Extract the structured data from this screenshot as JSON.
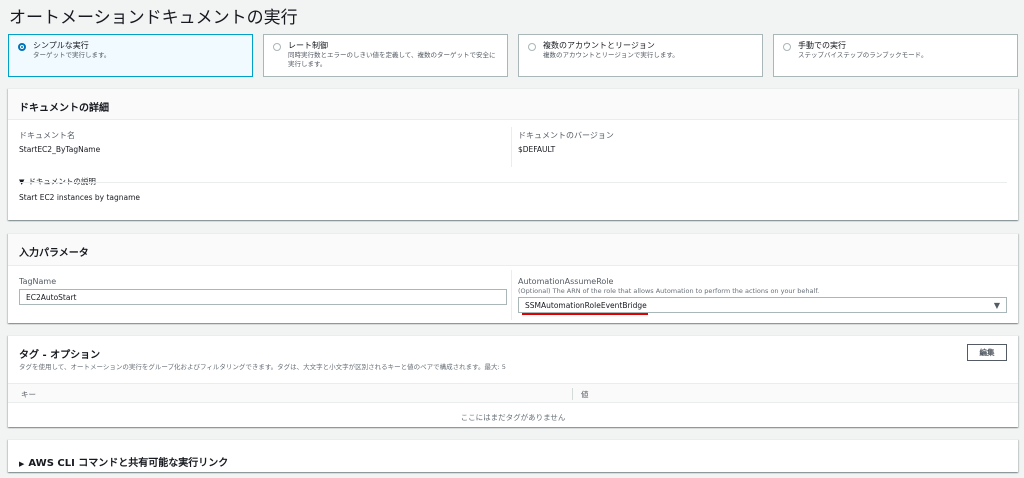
{
  "page": {
    "title": "オートメーションドキュメントの実行"
  },
  "options": [
    {
      "title": "シンプルな実行",
      "desc": "ターゲットで実行します。",
      "selected": true
    },
    {
      "title": "レート制御",
      "desc": "同時実行数とエラーのしきい値を定義して、複数のターゲットで安全に実行します。",
      "selected": false
    },
    {
      "title": "複数のアカウントとリージョン",
      "desc": "複数のアカウントとリージョンで実行します。",
      "selected": false
    },
    {
      "title": "手動での実行",
      "desc": "ステップバイステップのランブックモード。",
      "selected": false
    }
  ],
  "document_details": {
    "header": "ドキュメントの詳細",
    "name_label": "ドキュメント名",
    "name_value": "StartEC2_ByTagName",
    "version_label": "ドキュメントのバージョン",
    "version_value": "$DEFAULT",
    "description_toggle": "ドキュメントの説明",
    "description_value": "Start EC2 instances by tagname"
  },
  "input_params": {
    "header": "入力パラメータ",
    "tagname_label": "TagName",
    "tagname_value": "EC2AutoStart",
    "role_label": "AutomationAssumeRole",
    "role_hint": "(Optional) The ARN of the role that allows Automation to perform the actions on your behalf.",
    "role_value": "SSMAutomationRoleEventBridge"
  },
  "tags": {
    "header": "タグ - オプション",
    "desc": "タグを使用して、オートメーションの実行をグループ化およびフィルタリングできます。タグは、大文字と小文字が区別されるキーと値のペアで構成されます。最大: 5",
    "edit_button": "編集",
    "col_key": "キー",
    "col_value": "値",
    "empty_message": "ここにはまだタグがありません"
  },
  "cli": {
    "header": "AWS CLI コマンドと共有可能な実行リンク"
  },
  "colors": {
    "accent": "#0073bb",
    "selected_border": "#00a1c9",
    "highlight_underline": "#e00000"
  }
}
